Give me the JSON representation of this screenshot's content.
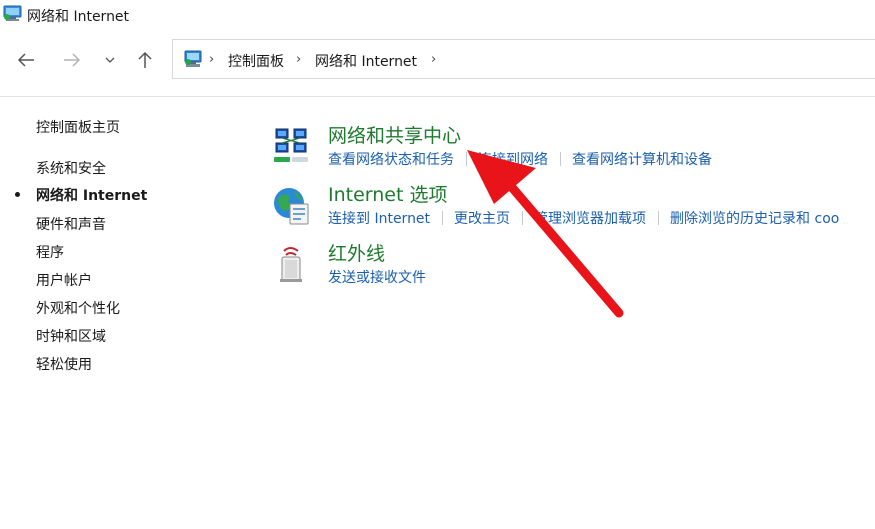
{
  "window": {
    "title": "网络和 Internet"
  },
  "address": {
    "breadcrumbs": [
      "控制面板",
      "网络和 Internet"
    ]
  },
  "sidebar": {
    "home": "控制面板主页",
    "items": [
      {
        "label": "系统和安全"
      },
      {
        "label": "网络和 Internet",
        "current": true
      },
      {
        "label": "硬件和声音"
      },
      {
        "label": "程序"
      },
      {
        "label": "用户帐户"
      },
      {
        "label": "外观和个性化"
      },
      {
        "label": "时钟和区域"
      },
      {
        "label": "轻松使用"
      }
    ]
  },
  "categories": [
    {
      "title": "网络和共享中心",
      "icon": "network-sharing-center-icon",
      "links": [
        "查看网络状态和任务",
        "连接到网络",
        "查看网络计算机和设备"
      ]
    },
    {
      "title": "Internet 选项",
      "icon": "internet-options-globe-icon",
      "links": [
        "连接到 Internet",
        "更改主页",
        "管理浏览器加载项",
        "删除浏览的历史记录和 coo"
      ]
    },
    {
      "title": "红外线",
      "icon": "infrared-icon",
      "links": [
        "发送或接收文件"
      ]
    }
  ],
  "colors": {
    "category_title": "#1e7a2e",
    "link": "#1b5fae",
    "annotation_arrow": "#e8141a"
  }
}
